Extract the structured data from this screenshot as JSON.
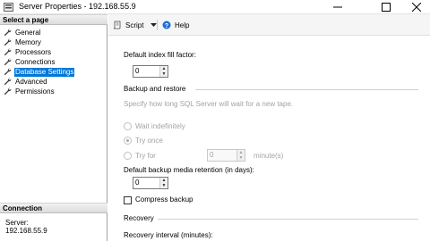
{
  "window": {
    "title": "Server Properties - 192.168.55.9"
  },
  "left": {
    "select_header": "Select a page",
    "pages": [
      {
        "label": "General",
        "selected": false
      },
      {
        "label": "Memory",
        "selected": false
      },
      {
        "label": "Processors",
        "selected": false
      },
      {
        "label": "Connections",
        "selected": false
      },
      {
        "label": "Database Settings",
        "selected": true
      },
      {
        "label": "Advanced",
        "selected": false
      },
      {
        "label": "Permissions",
        "selected": false
      }
    ],
    "connection_header": "Connection",
    "server_label": "Server:",
    "server_value": "192.168.55.9"
  },
  "toolbar": {
    "script_label": "Script",
    "help_label": "Help"
  },
  "settings": {
    "fill_factor_label": "Default index fill factor:",
    "fill_factor_value": "0",
    "backup_restore_header": "Backup and restore",
    "wait_description": "Specify how long SQL Server will wait for a new tape.",
    "wait_indefinitely": "Wait indefinitely",
    "try_once": "Try once",
    "try_for": "Try for",
    "try_for_value": "0",
    "try_for_unit": "minute(s)",
    "retention_label": "Default backup media retention (in days):",
    "retention_value": "0",
    "compress_backup": "Compress backup",
    "recovery_header": "Recovery",
    "recovery_interval_label": "Recovery interval (minutes):"
  },
  "colors": {
    "selection": "#0078d7",
    "disabled_text": "#a3a3a3"
  }
}
